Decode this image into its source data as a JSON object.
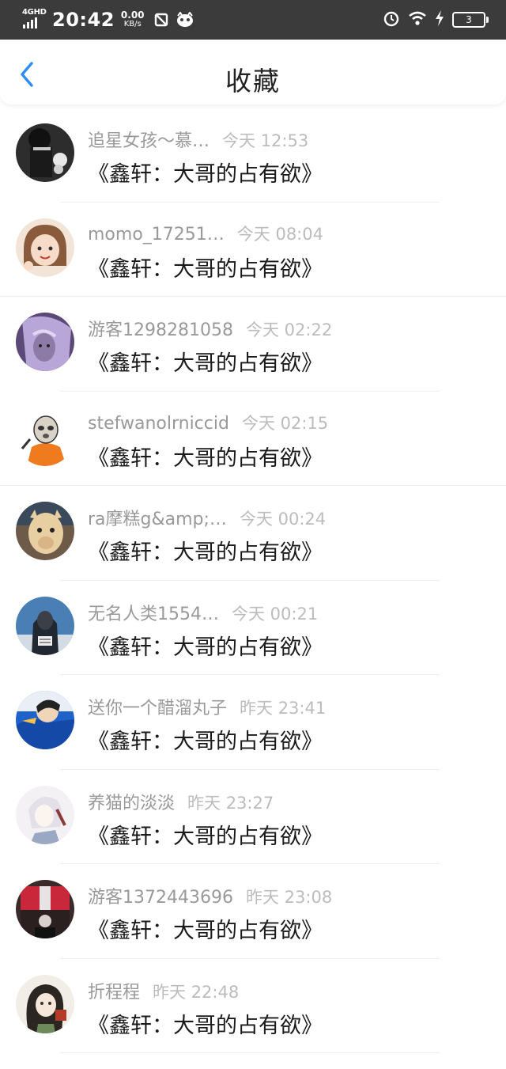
{
  "status_bar": {
    "network": "4GHD",
    "time": "20:42",
    "speed_value": "0.00",
    "speed_unit": "KB/s",
    "battery": "3",
    "icons": [
      "signal-icon",
      "no-sim-icon",
      "app-notification-icon",
      "alarm-icon",
      "wifi-icon",
      "charging-icon",
      "battery-icon"
    ]
  },
  "header": {
    "back_icon": "chevron-left-icon",
    "title": "收藏",
    "accent_color": "#2c8ef0"
  },
  "favorites": [
    {
      "name": "追星女孩～慕…",
      "time": "今天 12:53",
      "book": "《鑫轩：大哥的占有欲》"
    },
    {
      "name": "momo_17251…",
      "time": "今天 08:04",
      "book": "《鑫轩：大哥的占有欲》"
    },
    {
      "name": "游客1298281058",
      "time": "今天 02:22",
      "book": "《鑫轩：大哥的占有欲》"
    },
    {
      "name": "stefwanolrniccid",
      "time": "今天 02:15",
      "book": "《鑫轩：大哥的占有欲》"
    },
    {
      "name": "ra摩糕g&amp;…",
      "time": "今天 00:24",
      "book": "《鑫轩：大哥的占有欲》"
    },
    {
      "name": "无名人类1554…",
      "time": "今天 00:21",
      "book": "《鑫轩：大哥的占有欲》"
    },
    {
      "name": "送你一个醋溜丸子",
      "time": "昨天 23:41",
      "book": "《鑫轩：大哥的占有欲》"
    },
    {
      "name": "养猫的淡淡",
      "time": "昨天 23:27",
      "book": "《鑫轩：大哥的占有欲》"
    },
    {
      "name": "游客1372443696",
      "time": "昨天 23:08",
      "book": "《鑫轩：大哥的占有欲》"
    },
    {
      "name": "折程程",
      "time": "昨天 22:48",
      "book": "《鑫轩：大哥的占有欲》"
    }
  ]
}
